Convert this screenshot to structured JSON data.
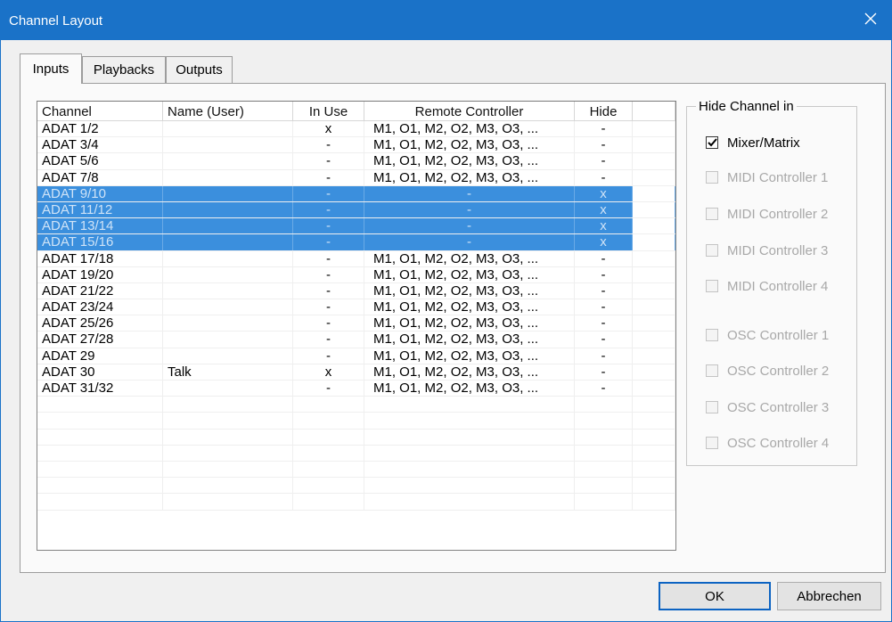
{
  "window": {
    "title": "Channel Layout",
    "close_icon": "close-icon"
  },
  "tabs": [
    {
      "label": "Inputs",
      "active": true
    },
    {
      "label": "Playbacks",
      "active": false
    },
    {
      "label": "Outputs",
      "active": false
    }
  ],
  "table": {
    "columns": [
      "Channel",
      "Name (User)",
      "In Use",
      "Remote Controller",
      "Hide"
    ],
    "rows": [
      {
        "channel": "ADAT 1/2",
        "name": "",
        "in_use": "x",
        "remote": "M1, O1, M2, O2, M3, O3, ...",
        "hide": "-",
        "selected": false
      },
      {
        "channel": "ADAT 3/4",
        "name": "",
        "in_use": "-",
        "remote": "M1, O1, M2, O2, M3, O3, ...",
        "hide": "-",
        "selected": false
      },
      {
        "channel": "ADAT 5/6",
        "name": "",
        "in_use": "-",
        "remote": "M1, O1, M2, O2, M3, O3, ...",
        "hide": "-",
        "selected": false
      },
      {
        "channel": "ADAT 7/8",
        "name": "",
        "in_use": "-",
        "remote": "M1, O1, M2, O2, M3, O3, ...",
        "hide": "-",
        "selected": false
      },
      {
        "channel": "ADAT 9/10",
        "name": "",
        "in_use": "-",
        "remote": "-",
        "hide": "x",
        "selected": true
      },
      {
        "channel": "ADAT 11/12",
        "name": "",
        "in_use": "-",
        "remote": "-",
        "hide": "x",
        "selected": true
      },
      {
        "channel": "ADAT 13/14",
        "name": "",
        "in_use": "-",
        "remote": "-",
        "hide": "x",
        "selected": true
      },
      {
        "channel": "ADAT 15/16",
        "name": "",
        "in_use": "-",
        "remote": "-",
        "hide": "x",
        "selected": true
      },
      {
        "channel": "ADAT 17/18",
        "name": "",
        "in_use": "-",
        "remote": "M1, O1, M2, O2, M3, O3, ...",
        "hide": "-",
        "selected": false
      },
      {
        "channel": "ADAT 19/20",
        "name": "",
        "in_use": "-",
        "remote": "M1, O1, M2, O2, M3, O3, ...",
        "hide": "-",
        "selected": false
      },
      {
        "channel": "ADAT 21/22",
        "name": "",
        "in_use": "-",
        "remote": "M1, O1, M2, O2, M3, O3, ...",
        "hide": "-",
        "selected": false
      },
      {
        "channel": "ADAT 23/24",
        "name": "",
        "in_use": "-",
        "remote": "M1, O1, M2, O2, M3, O3, ...",
        "hide": "-",
        "selected": false
      },
      {
        "channel": "ADAT 25/26",
        "name": "",
        "in_use": "-",
        "remote": "M1, O1, M2, O2, M3, O3, ...",
        "hide": "-",
        "selected": false
      },
      {
        "channel": "ADAT 27/28",
        "name": "",
        "in_use": "-",
        "remote": "M1, O1, M2, O2, M3, O3, ...",
        "hide": "-",
        "selected": false
      },
      {
        "channel": "ADAT 29",
        "name": "",
        "in_use": "-",
        "remote": "M1, O1, M2, O2, M3, O3, ...",
        "hide": "-",
        "selected": false
      },
      {
        "channel": "ADAT 30",
        "name": "Talk",
        "in_use": "x",
        "remote": "M1, O1, M2, O2, M3, O3, ...",
        "hide": "-",
        "selected": false
      },
      {
        "channel": "ADAT 31/32",
        "name": "",
        "in_use": "-",
        "remote": "M1, O1, M2, O2, M3, O3, ...",
        "hide": "-",
        "selected": false
      }
    ]
  },
  "hide_group": {
    "title": "Hide Channel in",
    "options": [
      {
        "label": "Mixer/Matrix",
        "checked": true,
        "enabled": true
      },
      {
        "label": "MIDI Controller 1",
        "checked": false,
        "enabled": false
      },
      {
        "label": "MIDI Controller 2",
        "checked": false,
        "enabled": false
      },
      {
        "label": "MIDI Controller 3",
        "checked": false,
        "enabled": false
      },
      {
        "label": "MIDI Controller 4",
        "checked": false,
        "enabled": false
      },
      {
        "label": "OSC Controller 1",
        "checked": false,
        "enabled": false
      },
      {
        "label": "OSC Controller 2",
        "checked": false,
        "enabled": false
      },
      {
        "label": "OSC Controller 3",
        "checked": false,
        "enabled": false
      },
      {
        "label": "OSC Controller 4",
        "checked": false,
        "enabled": false
      }
    ]
  },
  "buttons": {
    "ok": "OK",
    "cancel": "Abbrechen"
  },
  "colors": {
    "titlebar": "#1a72c8",
    "selection": "#3b8fdd",
    "default_button_border": "#0c63c2"
  }
}
